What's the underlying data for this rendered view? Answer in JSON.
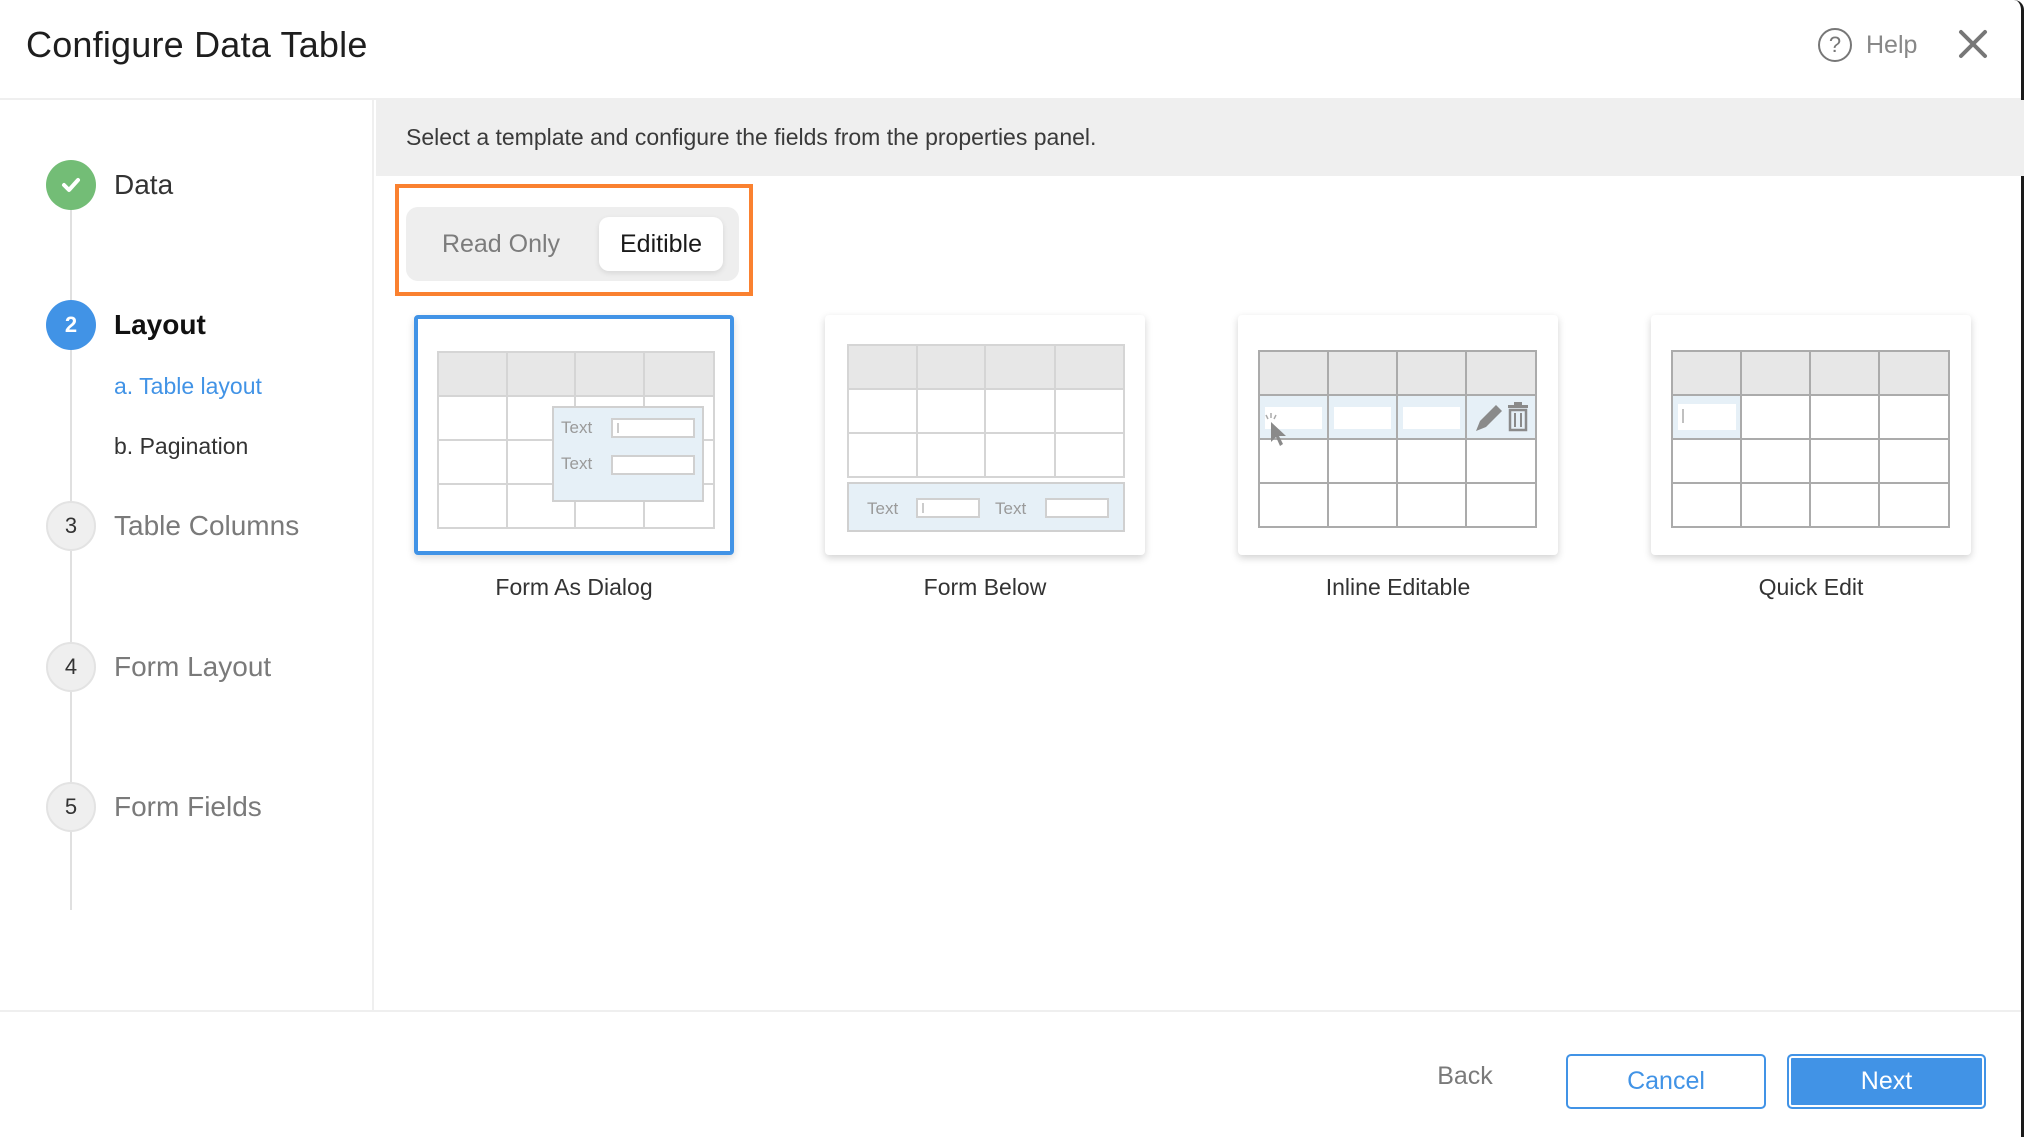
{
  "header": {
    "title": "Configure Data Table",
    "help_label": "Help",
    "help_icon": "question-circle-icon",
    "close_icon": "close-icon"
  },
  "sidebar": {
    "steps": [
      {
        "number": "1",
        "label": "Data",
        "status": "done",
        "icon": "check-icon"
      },
      {
        "number": "2",
        "label": "Layout",
        "status": "active",
        "substeps": [
          {
            "label": "a. Table layout",
            "status": "active"
          },
          {
            "label": "b. Pagination",
            "status": "normal"
          }
        ]
      },
      {
        "number": "3",
        "label": "Table Columns",
        "status": "pending"
      },
      {
        "number": "4",
        "label": "Form Layout",
        "status": "pending"
      },
      {
        "number": "5",
        "label": "Form Fields",
        "status": "pending"
      }
    ]
  },
  "main": {
    "instruction": "Select a template and configure the fields from the properties panel.",
    "mode_toggle": {
      "options": [
        "Read Only",
        "Editible"
      ],
      "selected": "Editible"
    },
    "templates": [
      {
        "label": "Form As Dialog",
        "selected": true,
        "preview_text": [
          "Text",
          "Text"
        ]
      },
      {
        "label": "Form Below",
        "selected": false,
        "preview_text": [
          "Text",
          "Text"
        ]
      },
      {
        "label": "Inline Editable",
        "selected": false,
        "preview_icons": [
          "pencil-icon",
          "trash-icon",
          "cursor-icon"
        ]
      },
      {
        "label": "Quick Edit",
        "selected": false
      }
    ]
  },
  "footer": {
    "back_label": "Back",
    "cancel_label": "Cancel",
    "next_label": "Next"
  },
  "colors": {
    "accent": "#4193e6",
    "success": "#73bd76",
    "highlight": "#fa8130",
    "instruction_bg": "#efefef"
  }
}
